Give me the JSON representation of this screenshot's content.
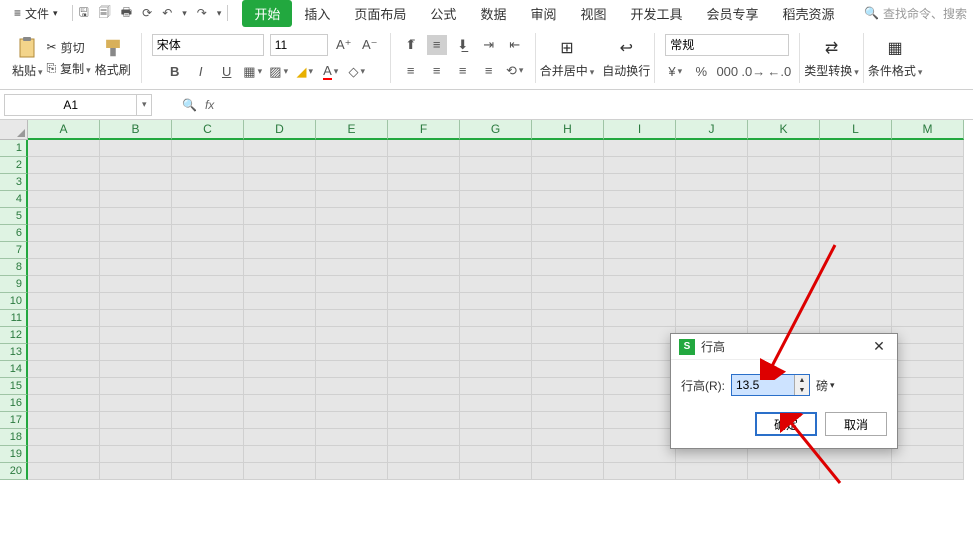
{
  "menu": {
    "file": "文件",
    "qat_icons": [
      "save-icon",
      "saveas-icon",
      "print-icon",
      "preview-icon",
      "undo-icon",
      "redo-icon"
    ],
    "tabs": [
      {
        "label": "开始",
        "active": true
      },
      {
        "label": "插入"
      },
      {
        "label": "页面布局"
      },
      {
        "label": "公式"
      },
      {
        "label": "数据"
      },
      {
        "label": "审阅"
      },
      {
        "label": "视图"
      },
      {
        "label": "开发工具"
      },
      {
        "label": "会员专享"
      },
      {
        "label": "稻壳资源"
      }
    ],
    "search_placeholder": "查找命令、搜索"
  },
  "ribbon": {
    "paste": "粘贴",
    "cut": "剪切",
    "copy": "复制",
    "format_painter": "格式刷",
    "font_name": "宋体",
    "font_size": "11",
    "merge_center": "合并居中",
    "auto_wrap": "自动换行",
    "number_format": "常规",
    "type_convert": "类型转换",
    "cond_format": "条件格式"
  },
  "formula_bar": {
    "name_box": "A1",
    "fx": "fx"
  },
  "grid": {
    "columns": [
      "A",
      "B",
      "C",
      "D",
      "E",
      "F",
      "G",
      "H",
      "I",
      "J",
      "K",
      "L",
      "M"
    ],
    "row_count": 20
  },
  "dialog": {
    "title": "行高",
    "label": "行高(R):",
    "value": "13.5",
    "unit": "磅",
    "ok": "确定",
    "cancel": "取消"
  }
}
